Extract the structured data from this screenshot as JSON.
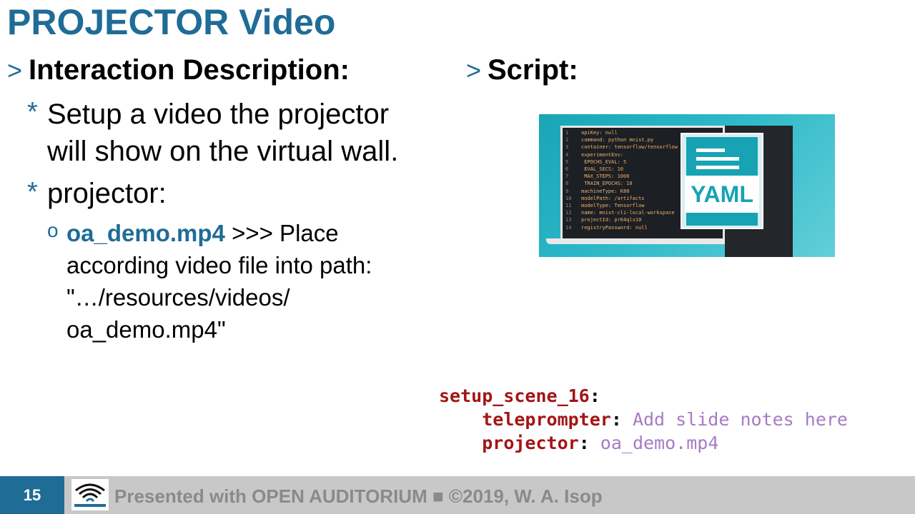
{
  "title": "PROJECTOR Video",
  "left": {
    "heading": "Interaction Description:",
    "bullets": [
      {
        "line1": "Setup a video the projector",
        "line2": "will show on the virtual wall."
      },
      {
        "line1": "projector:"
      }
    ],
    "sub": {
      "filename": "oa_demo.mp4",
      "rest": " >>> Place",
      "line2": "according video file into path:",
      "line3": "\"…/resources/videos/",
      "line4": "oa_demo.mp4\""
    }
  },
  "right": {
    "heading": "Script:",
    "image": {
      "label": "YAML",
      "code_lines": [
        {
          "n": "1",
          "t": "apiKey: null"
        },
        {
          "n": "2",
          "t": "command: python mnist.py"
        },
        {
          "n": "3",
          "t": "container: tensorflow/tensorflow"
        },
        {
          "n": "4",
          "t": "experimentEnv:"
        },
        {
          "n": "5",
          "t": "  EPOCHS_EVAL: 5"
        },
        {
          "n": "6",
          "t": "  EVAL_SECS: 10"
        },
        {
          "n": "7",
          "t": "  MAX_STEPS: 1000"
        },
        {
          "n": "8",
          "t": "  TRAIN_EPOCHS: 10"
        },
        {
          "n": "9",
          "t": "machineType: K80"
        },
        {
          "n": "10",
          "t": "modelPath: /artifacts"
        },
        {
          "n": "11",
          "t": "modelType: Tensorflow"
        },
        {
          "n": "12",
          "t": "name: mnist-cli-local-workspace"
        },
        {
          "n": "13",
          "t": "projectId: pr64qlx10"
        },
        {
          "n": "14",
          "t": "registryPassword: null"
        }
      ]
    },
    "snippet": {
      "scene_key": "setup_scene_16",
      "tele_key": "teleprompter",
      "tele_val": "Add slide notes here",
      "proj_key": "projector",
      "proj_val": "oa_demo.mp4"
    }
  },
  "footer": {
    "page": "15",
    "text": "Presented with OPEN AUDITORIUM ■ ©2019, W. A. Isop"
  }
}
